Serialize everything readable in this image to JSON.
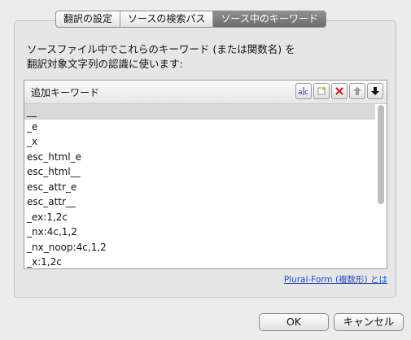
{
  "tabs": [
    {
      "label": "翻訳の設定",
      "active": false
    },
    {
      "label": "ソースの検索パス",
      "active": false
    },
    {
      "label": "ソース中のキーワード",
      "active": true
    }
  ],
  "description_line1": "ソースファイル中でこれらのキーワード (または関数名) を",
  "description_line2": "翻訳対象文字列の認識に使います:",
  "list": {
    "header": "追加キーワード",
    "items": [
      "__",
      "_e",
      "_x",
      "esc_html_e",
      "esc_html__",
      "esc_attr_e",
      "esc_attr__",
      "_ex:1,2c",
      "_nx:4c,1,2",
      "_nx_noop:4c,1,2",
      "_x:1,2c"
    ],
    "selected_index": 0,
    "toolbar_icons": [
      "rename-icon",
      "add-icon",
      "delete-icon",
      "move-up-icon",
      "move-down-icon"
    ]
  },
  "plural_link": "Plural-Form (複数形) とは",
  "buttons": {
    "ok": "OK",
    "cancel": "キャンセル"
  },
  "colors": {
    "active_tab": "#7d7d7d",
    "link": "#2a4fc1",
    "delete_red": "#cc1f1f"
  }
}
